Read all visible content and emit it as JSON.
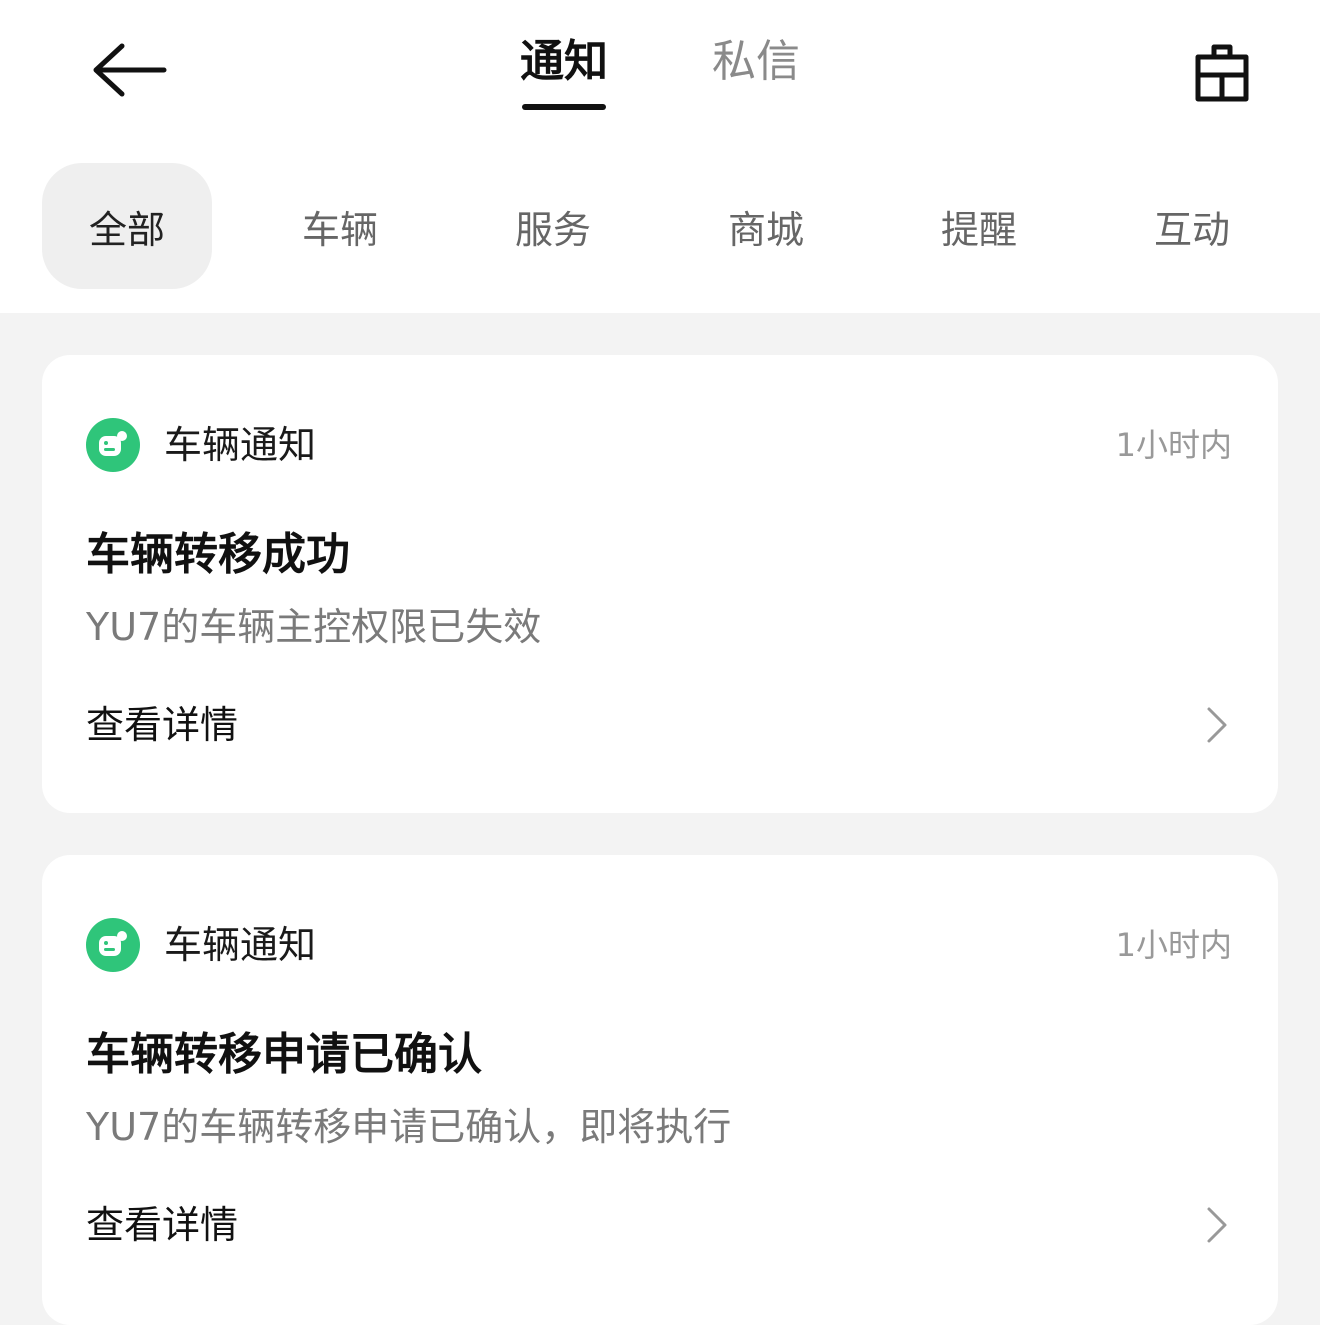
{
  "header": {
    "tabs": [
      {
        "label": "通知",
        "active": true
      },
      {
        "label": "私信",
        "active": false
      }
    ]
  },
  "filters": [
    {
      "label": "全部",
      "active": true
    },
    {
      "label": "车辆",
      "active": false
    },
    {
      "label": "服务",
      "active": false
    },
    {
      "label": "商城",
      "active": false
    },
    {
      "label": "提醒",
      "active": false
    },
    {
      "label": "互动",
      "active": false
    }
  ],
  "notifications": [
    {
      "source": "车辆通知",
      "time": "1小时内",
      "title": "车辆转移成功",
      "description": "YU7的车辆主控权限已失效",
      "action_label": "查看详情"
    },
    {
      "source": "车辆通知",
      "time": "1小时内",
      "title": "车辆转移申请已确认",
      "description": "YU7的车辆转移申请已确认，即将执行",
      "action_label": "查看详情"
    }
  ],
  "colors": {
    "accent_green": "#2fc57a",
    "page_background": "#f3f3f3",
    "card_background": "#ffffff",
    "active_chip": "#efefef"
  },
  "icons": {
    "back": "arrow-left-icon",
    "clear": "broom-icon",
    "source": "vehicle-bot-icon",
    "details": "chevron-right-icon"
  }
}
